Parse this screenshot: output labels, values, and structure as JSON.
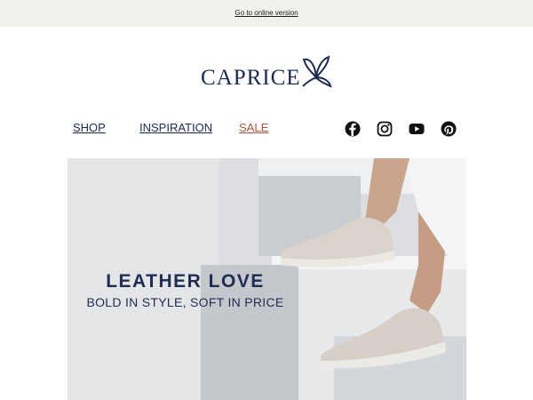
{
  "topbar": {
    "online_link": "Go to online version"
  },
  "brand": {
    "name": "CAPRICE",
    "logo_icon": "butterfly-icon"
  },
  "nav": {
    "shop": "SHOP",
    "inspiration": "INSPIRATION",
    "sale": "SALE"
  },
  "social": [
    "facebook-icon",
    "instagram-icon",
    "youtube-icon",
    "pinterest-icon"
  ],
  "hero": {
    "title": "LEATHER LOVE",
    "subtitle": "BOLD IN STYLE, SOFT IN PRICE"
  },
  "colors": {
    "brand_navy": "#1c2a4e",
    "sale": "#b1543a",
    "topbar_bg": "#f2f1ee"
  }
}
